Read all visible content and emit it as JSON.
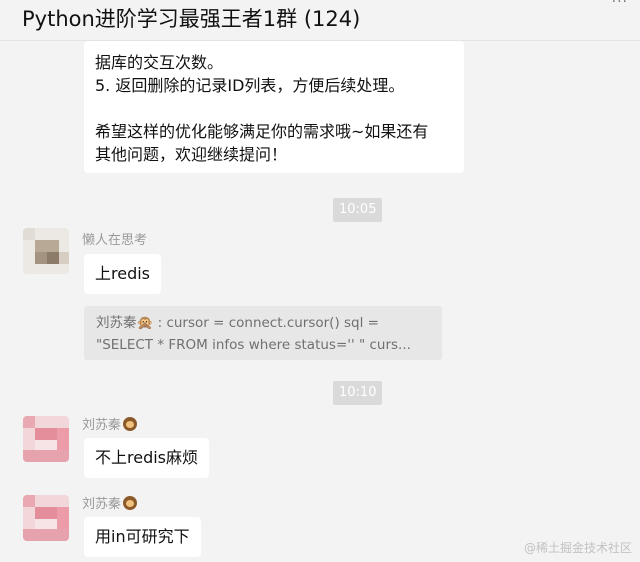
{
  "window": {
    "title": "Python进阶学习最强王者1群 (124)",
    "dots": "···"
  },
  "messages": {
    "bot_reply_lines": [
      "据库的交互次数。",
      "5. 返回删除的记录ID列表，方便后续处理。",
      "",
      "希望这样的优化能够满足你的需求哦~如果还有",
      "其他问题，欢迎继续提问！"
    ],
    "time1": "10:05",
    "msg2": {
      "sender": "懒人在思考",
      "text": "上redis"
    },
    "quote": {
      "line1": "刘苏秦🙊 : cursor = connect.cursor()      sql =",
      "line2": "\"SELECT * FROM infos where status='' \"     curs..."
    },
    "time2": "10:10",
    "msg3": {
      "sender": "刘苏秦",
      "text": "不上redis麻烦"
    },
    "msg4": {
      "sender": "刘苏秦",
      "text": "用in可研究下"
    }
  },
  "watermark": "@稀土掘金技术社区",
  "colors": {
    "background": "#f3f3f3",
    "bubble": "#ffffff",
    "time_badge": "#dadada",
    "quote_bg": "#e7e7e7"
  }
}
